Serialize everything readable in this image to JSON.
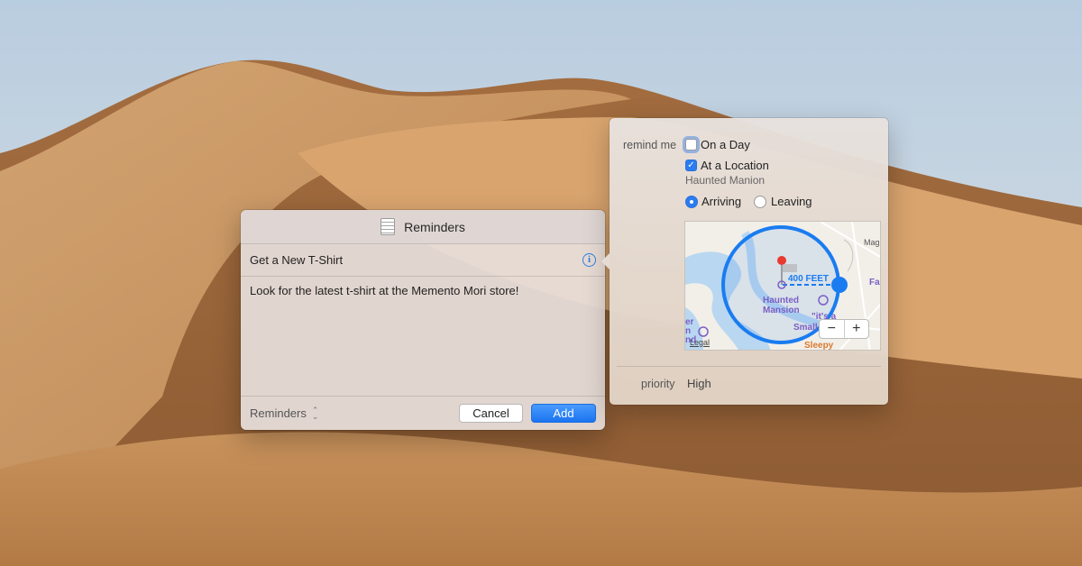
{
  "panel": {
    "title": "Reminders",
    "reminder_title": "Get a New T-Shirt",
    "notes": "Look for the latest t-shirt at the Memento Mori store!",
    "list_name": "Reminders",
    "cancel_label": "Cancel",
    "add_label": "Add"
  },
  "popover": {
    "remind_me_label": "remind me",
    "on_a_day_label": "On a Day",
    "on_a_day_checked": false,
    "at_location_label": "At a Location",
    "at_location_checked": true,
    "location_name": "Haunted Manion",
    "arriving_label": "Arriving",
    "leaving_label": "Leaving",
    "selected_trigger": "Arriving",
    "priority_label": "priority",
    "priority_value": "High"
  },
  "map": {
    "radius_label": "400 FEET",
    "place_label_line1": "Haunted",
    "place_label_line2": "Mansion",
    "label_its_a": "\"it's a",
    "label_small": "Small",
    "label_sleepy": "Sleepy",
    "label_mag": "Mag",
    "label_fa": "Fa",
    "label_left_1": "er",
    "label_left_2": "n",
    "label_left_3": "nd",
    "legal_label": "Legal",
    "zoom_out": "−",
    "zoom_in": "+"
  },
  "colors": {
    "accent": "#2a7cf0",
    "geofence": "#1a7cf0",
    "pin": "#e83a2f",
    "water": "#b9d7f0"
  },
  "icons": {
    "app": "reminders-list-icon",
    "info": "info-icon",
    "updown": "up-down-chevron-icon",
    "pin": "map-pin-icon",
    "poi": "attraction-icon"
  }
}
